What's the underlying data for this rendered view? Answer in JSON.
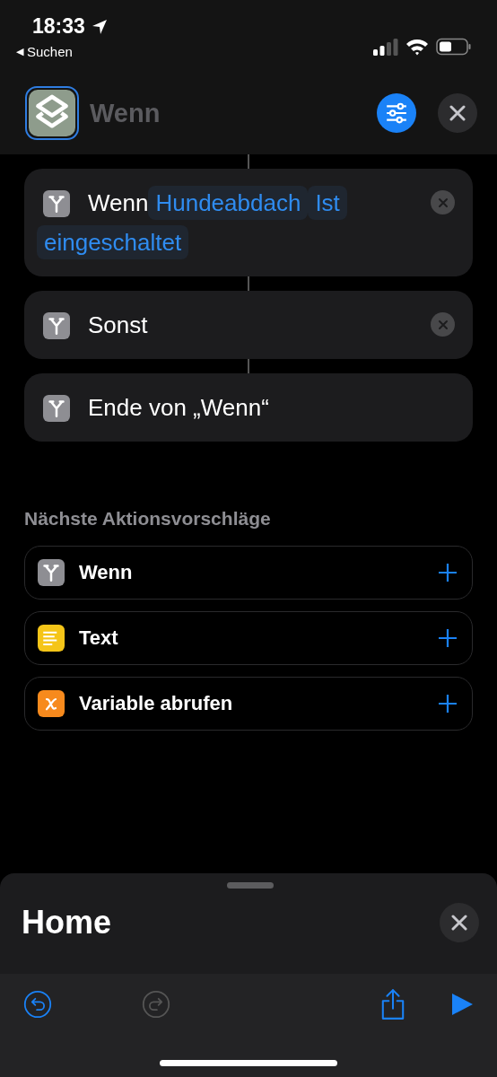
{
  "status_bar": {
    "time": "18:33",
    "back_arrow": "◀",
    "back_label": "Suchen"
  },
  "header": {
    "title": "Wenn"
  },
  "actions": [
    {
      "kind": "if",
      "label": "Wenn",
      "tokens": [
        "Hundeabdach",
        "Ist",
        "eingeschaltet"
      ],
      "removable": true
    },
    {
      "kind": "if",
      "label": "Sonst",
      "removable": true
    },
    {
      "kind": "if",
      "label": "Ende von „Wenn“",
      "removable": false
    }
  ],
  "suggestions": {
    "title": "Nächste Aktionsvorschläge",
    "items": [
      {
        "kind": "if",
        "label": "Wenn",
        "color": "#8e8e93"
      },
      {
        "kind": "text",
        "label": "Text",
        "color": "#f5c518"
      },
      {
        "kind": "variable",
        "label": "Variable abrufen",
        "color": "#f78a1d"
      }
    ]
  },
  "sheet": {
    "title": "Home"
  },
  "toolbar": {
    "undo_disabled": false,
    "redo_disabled": true
  }
}
